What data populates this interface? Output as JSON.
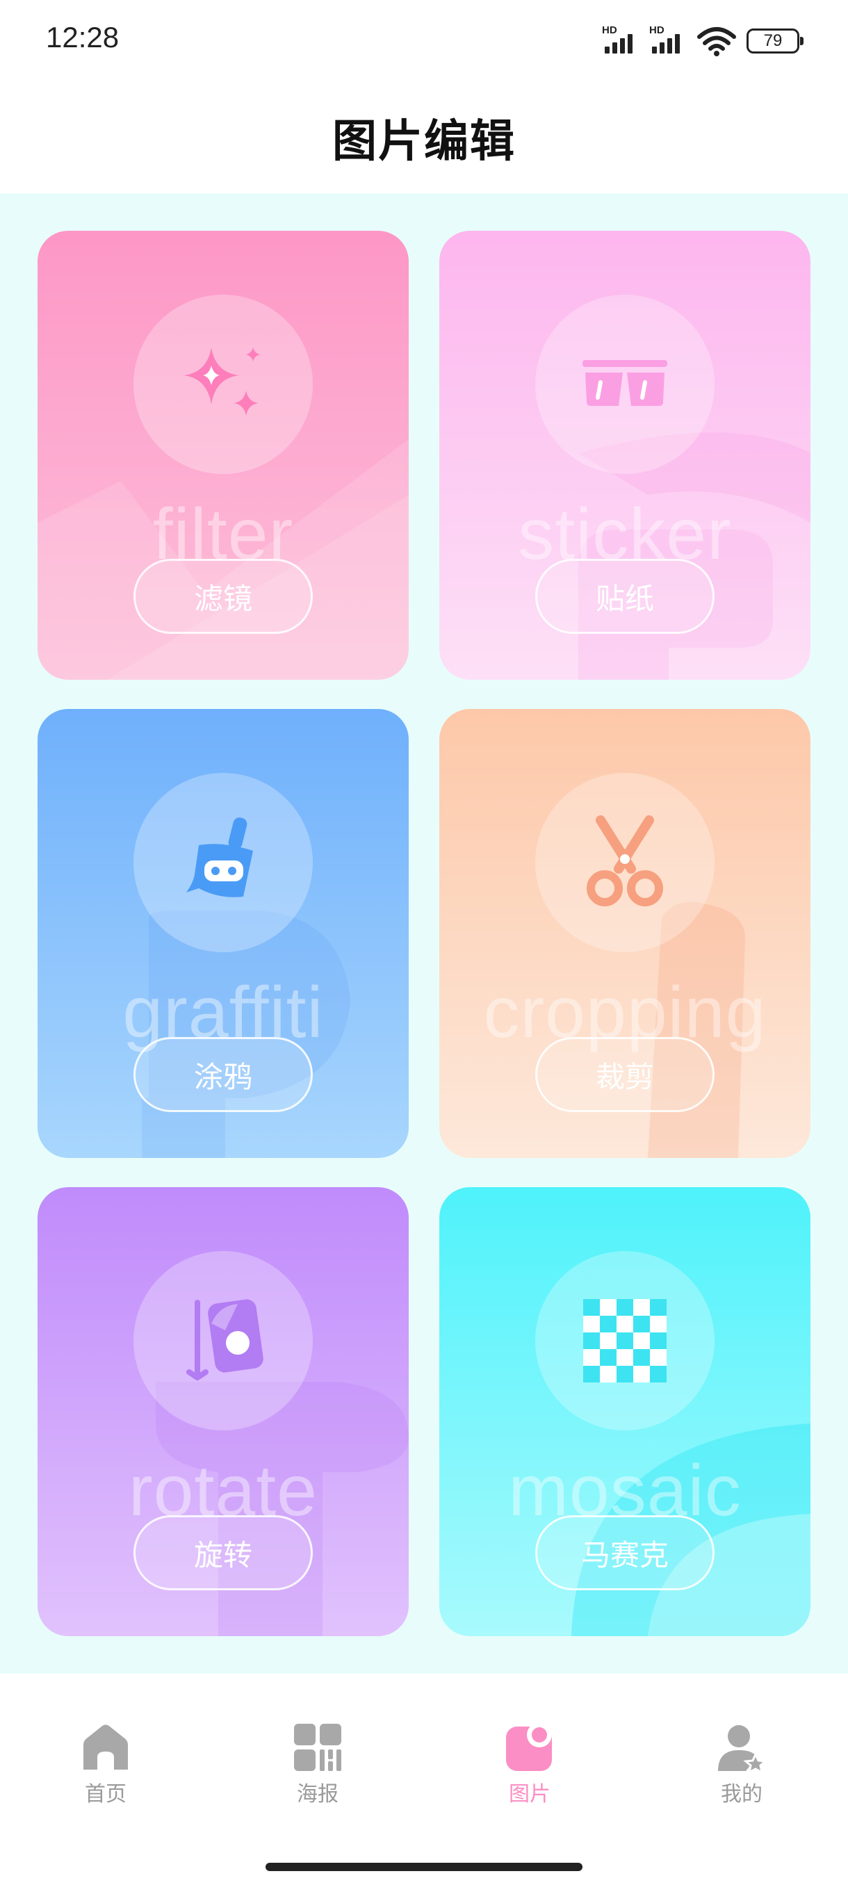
{
  "status_bar": {
    "time": "12:28",
    "signal1_label": "HD",
    "signal2_label": "HD",
    "wifi_icon": "wifi-icon",
    "battery_level": "79"
  },
  "header": {
    "title": "图片编辑"
  },
  "cards": [
    {
      "id": "filter",
      "english": "filter",
      "label": "滤镜",
      "icon": "sparkle-icon"
    },
    {
      "id": "sticker",
      "english": "sticker",
      "label": "贴纸",
      "icon": "sticker-icon"
    },
    {
      "id": "graffiti",
      "english": "graffiti",
      "label": "涂鸦",
      "icon": "brush-icon"
    },
    {
      "id": "cropping",
      "english": "cropping",
      "label": "裁剪",
      "icon": "scissors-icon"
    },
    {
      "id": "rotate",
      "english": "rotate",
      "label": "旋转",
      "icon": "rotate-icon"
    },
    {
      "id": "mosaic",
      "english": "mosaic",
      "label": "马赛克",
      "icon": "mosaic-icon"
    }
  ],
  "bottom_nav": {
    "active": "图片",
    "active_color": "#fb8ec4",
    "inactive_color": "#a8a8a8",
    "items": [
      {
        "label": "首页",
        "icon": "home-icon"
      },
      {
        "label": "海报",
        "icon": "poster-grid-icon"
      },
      {
        "label": "图片",
        "icon": "image-icon"
      },
      {
        "label": "我的",
        "icon": "profile-icon"
      }
    ]
  }
}
